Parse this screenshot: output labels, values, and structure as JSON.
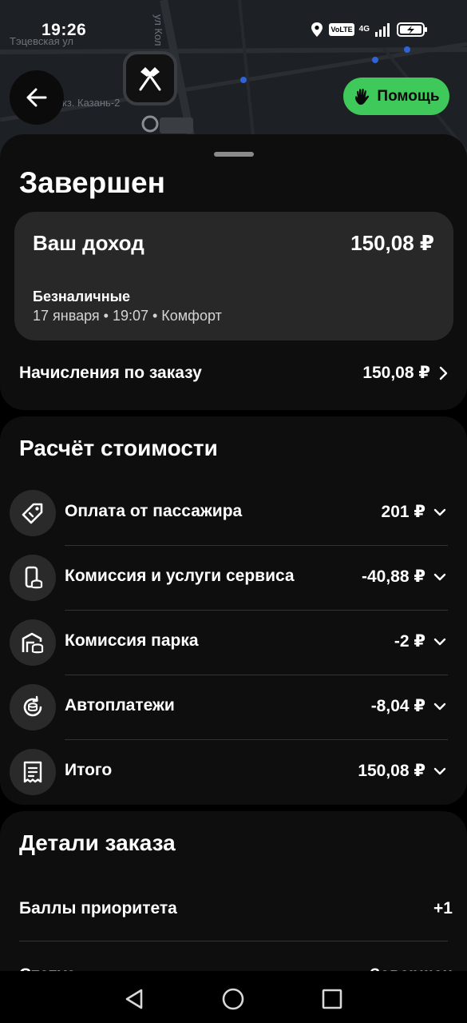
{
  "status_bar": {
    "time": "19:26",
    "volte": "VoLTE",
    "network": "4G",
    "icons": [
      "location-icon",
      "signal-icon",
      "battery-charging-icon"
    ]
  },
  "map": {
    "street_1": "Тэцевская ул",
    "street_2": "ул Кол",
    "station": "кз. Казань-2"
  },
  "header": {
    "help_label": "Помощь"
  },
  "order": {
    "status_title": "Завершен",
    "income_label": "Ваш доход",
    "income_value": "150,08 ₽",
    "payment_type": "Безналичные",
    "meta": "17 января • 19:07 • Комфорт",
    "accruals_label": "Начисления по заказу",
    "accruals_value": "150,08 ₽"
  },
  "cost": {
    "title": "Расчёт стоимости",
    "rows": [
      {
        "label": "Оплата от пассажира",
        "value": "201 ₽",
        "icon": "tag-icon"
      },
      {
        "label": "Комиссия и услуги сервиса",
        "value": "-40,88 ₽",
        "icon": "phone-coins-icon"
      },
      {
        "label": "Комиссия парка",
        "value": "-2 ₽",
        "icon": "garage-coins-icon"
      },
      {
        "label": "Автоплатежи",
        "value": "-8,04 ₽",
        "icon": "autopay-icon"
      },
      {
        "label": "Итого",
        "value": "150,08 ₽",
        "icon": "receipt-icon"
      }
    ]
  },
  "details": {
    "title": "Детали заказа",
    "priority_label": "Баллы приоритета",
    "priority_value": "+1",
    "status_label": "Статус",
    "status_value": "Завершен"
  },
  "colors": {
    "accent_green": "#3fc95a",
    "card_bg": "#0e0e0e",
    "inner_card_bg": "#282828"
  }
}
